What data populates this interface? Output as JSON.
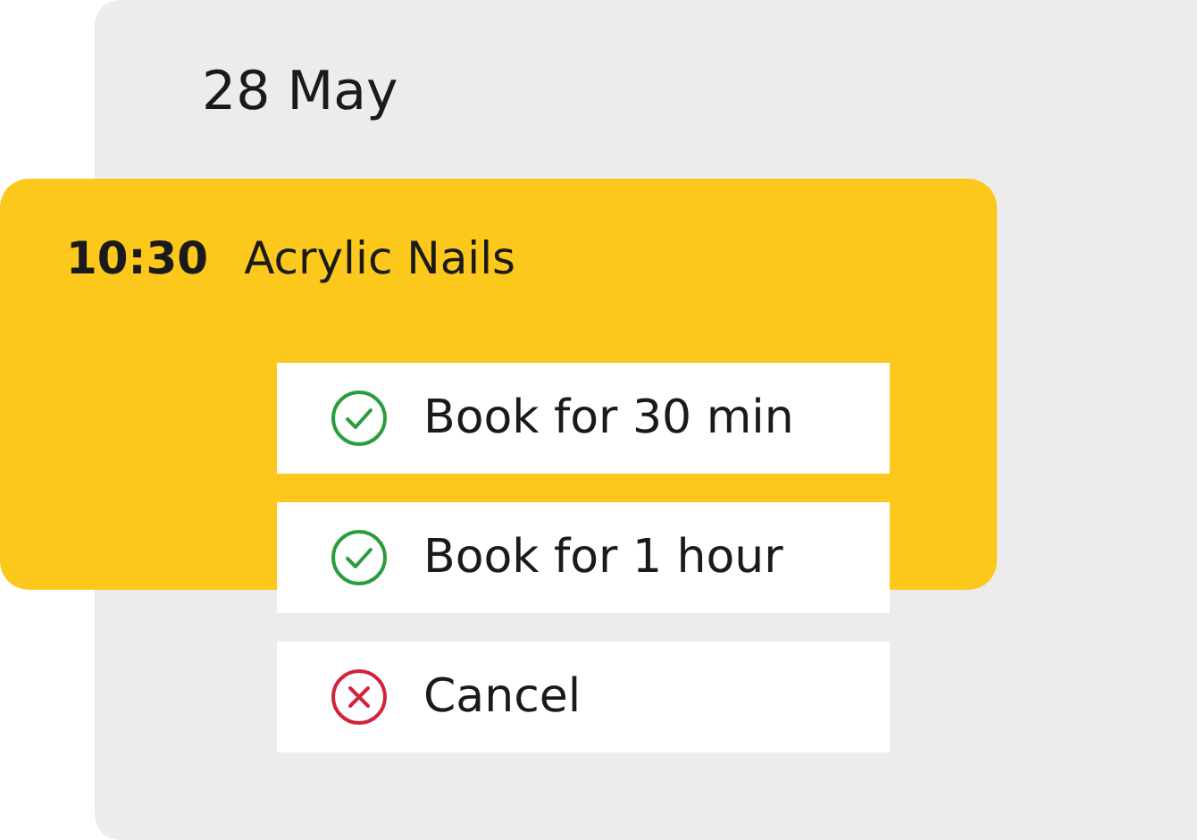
{
  "date": "28 May",
  "appointment": {
    "time": "10:30",
    "service": "Acrylic Nails"
  },
  "actions": [
    {
      "label": "Book for 30 min",
      "kind": "confirm"
    },
    {
      "label": "Book for 1 hour",
      "kind": "confirm"
    },
    {
      "label": "Cancel",
      "kind": "cancel"
    }
  ]
}
